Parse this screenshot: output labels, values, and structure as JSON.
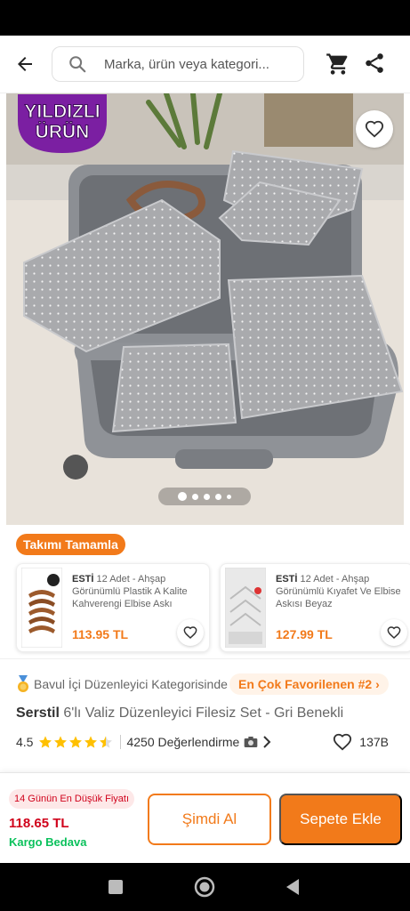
{
  "search": {
    "placeholder": "Marka, ürün veya kategori..."
  },
  "product_image": {
    "badge_line1": "YILDIZLI",
    "badge_line2": "ÜRÜN",
    "badge_color": "#7b1fa2",
    "carousel": {
      "count": 5,
      "active_index": 1
    }
  },
  "complete_set": {
    "label": "Takımı Tamamla",
    "items": [
      {
        "brand": "ESTİ",
        "title": "12 Adet - Ahşap Görünümlü Plastik A Kalite Kahverengi Elbise Askı",
        "price": "113.95 TL"
      },
      {
        "brand": "ESTİ",
        "title": "12 Adet - Ahşap Görünümlü Kıyafet Ve Elbise Askısı Beyaz",
        "price": "127.99 TL"
      }
    ]
  },
  "product": {
    "category_text": "Bavul İçi Düzenleyici Kategorisinde",
    "fav_rank": "En Çok Favorilenen #2",
    "brand": "Serstil",
    "name": "6'lı Valiz Düzenleyici Filesiz Set - Gri Benekli",
    "rating": "4.5",
    "stars": 4.5,
    "reviews": "4250 Değerlendirme",
    "likes": "137B"
  },
  "bottom": {
    "lowest_badge": "14 Günün En Düşük Fiyatı",
    "price": "118.65 TL",
    "shipping": "Kargo Bedava",
    "buy_now": "Şimdi Al",
    "add_to_cart": "Sepete Ekle"
  },
  "colors": {
    "accent": "#f27a1a",
    "price_red": "#d0021b",
    "shipping_green": "#0bc15c"
  }
}
